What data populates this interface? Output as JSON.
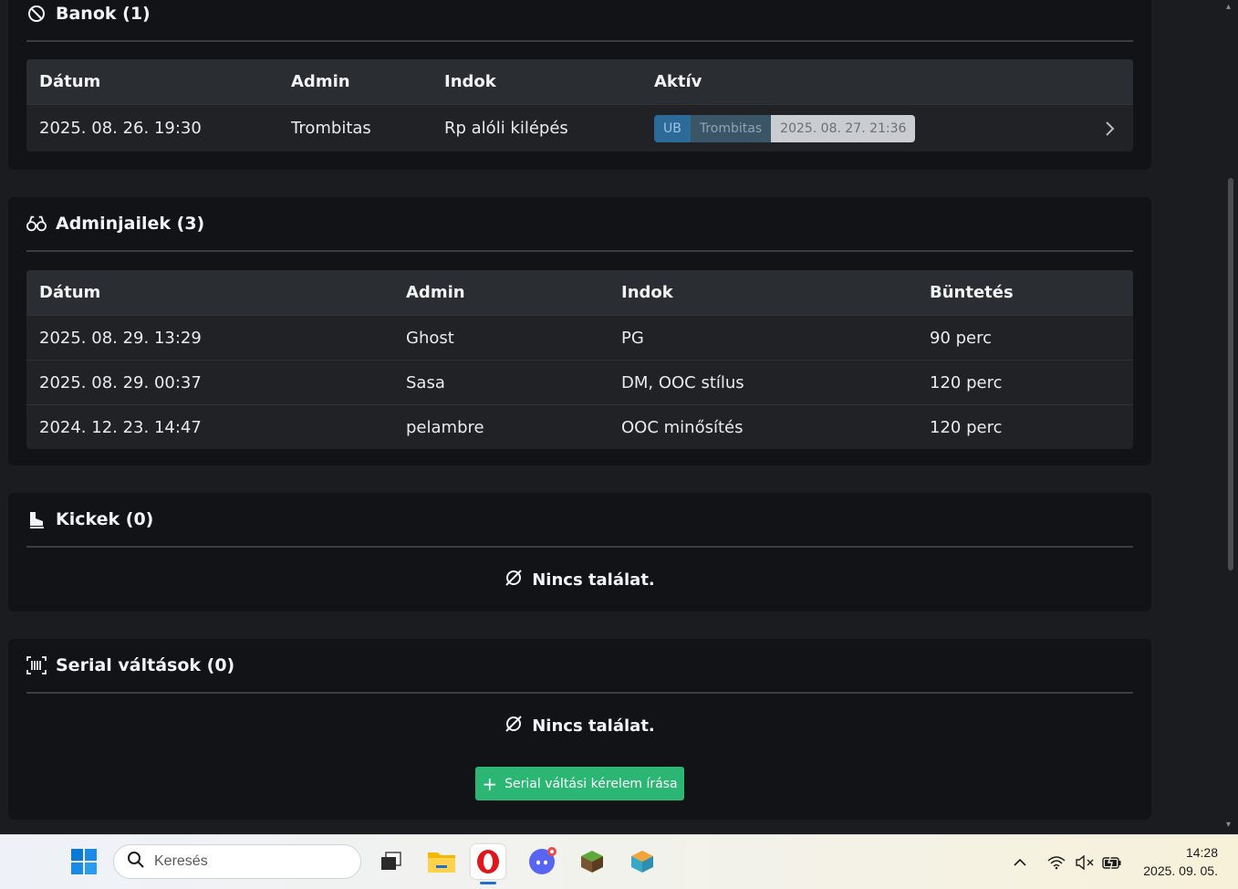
{
  "bans": {
    "title": "Banok (1)",
    "columns": [
      "Dátum",
      "Admin",
      "Indok",
      "Aktív"
    ],
    "rows": [
      {
        "date": "2025. 08. 26. 19:30",
        "admin": "Trombitas",
        "reason": "Rp alóli kilépés",
        "active": {
          "tag": "UB",
          "by": "Trombitas",
          "until": "2025. 08. 27. 21:36"
        }
      }
    ]
  },
  "adminjails": {
    "title": "Adminjailek (3)",
    "columns": [
      "Dátum",
      "Admin",
      "Indok",
      "Büntetés"
    ],
    "rows": [
      {
        "date": "2025. 08. 29. 13:29",
        "admin": "Ghost",
        "reason": "PG",
        "penalty": "90 perc"
      },
      {
        "date": "2025. 08. 29. 00:37",
        "admin": "Sasa",
        "reason": "DM, OOC stílus",
        "penalty": "120 perc"
      },
      {
        "date": "2024. 12. 23. 14:47",
        "admin": "pelambre",
        "reason": "OOC minősítés",
        "penalty": "120 perc"
      }
    ]
  },
  "kicks": {
    "title": "Kickek (0)",
    "empty": "Nincs találat."
  },
  "serials": {
    "title": "Serial váltások (0)",
    "empty": "Nincs találat.",
    "button": "Serial váltási kérelem írása"
  },
  "colors": {
    "accent_green": "#2bb673",
    "ub_badge": "#2c6a9a",
    "by_badge": "#3a5566",
    "date_badge": "#c9ccd1"
  },
  "taskbar": {
    "search_placeholder": "Keresés",
    "apps": [
      "windows-start",
      "task-view",
      "file-explorer",
      "opera",
      "discord",
      "minecraft",
      "app-cube"
    ],
    "time": "14:28",
    "date": "2025. 09. 05."
  }
}
